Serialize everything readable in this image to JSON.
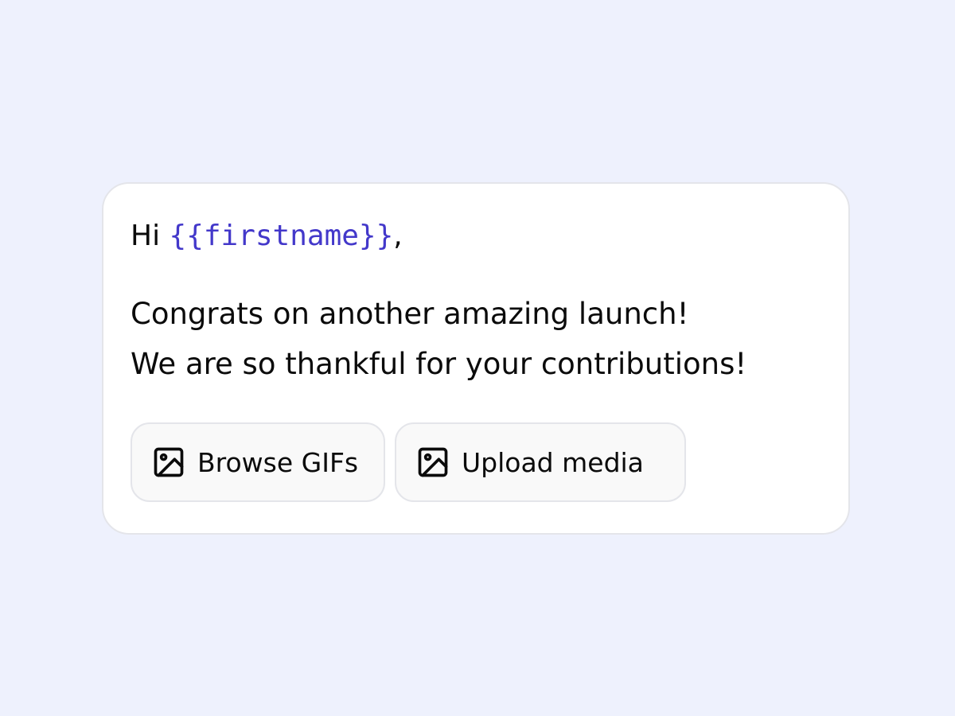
{
  "message_card": {
    "greeting_prefix": "Hi ",
    "token": "{{firstname}}",
    "greeting_suffix": ",",
    "body_lines": [
      "Congrats on another amazing launch!",
      "We are so thankful for your contributions!"
    ]
  },
  "actions": {
    "browse_gifs": {
      "label": "Browse GIFs",
      "icon": "image-icon"
    },
    "upload_media": {
      "label": "Upload media",
      "icon": "image-icon"
    }
  },
  "colors": {
    "page_background": "#eef1fd",
    "card_background": "#ffffff",
    "token_color": "#4338ca",
    "button_background": "#f9f9f9",
    "border": "#e4e5ea",
    "text": "#0b0b0b"
  }
}
